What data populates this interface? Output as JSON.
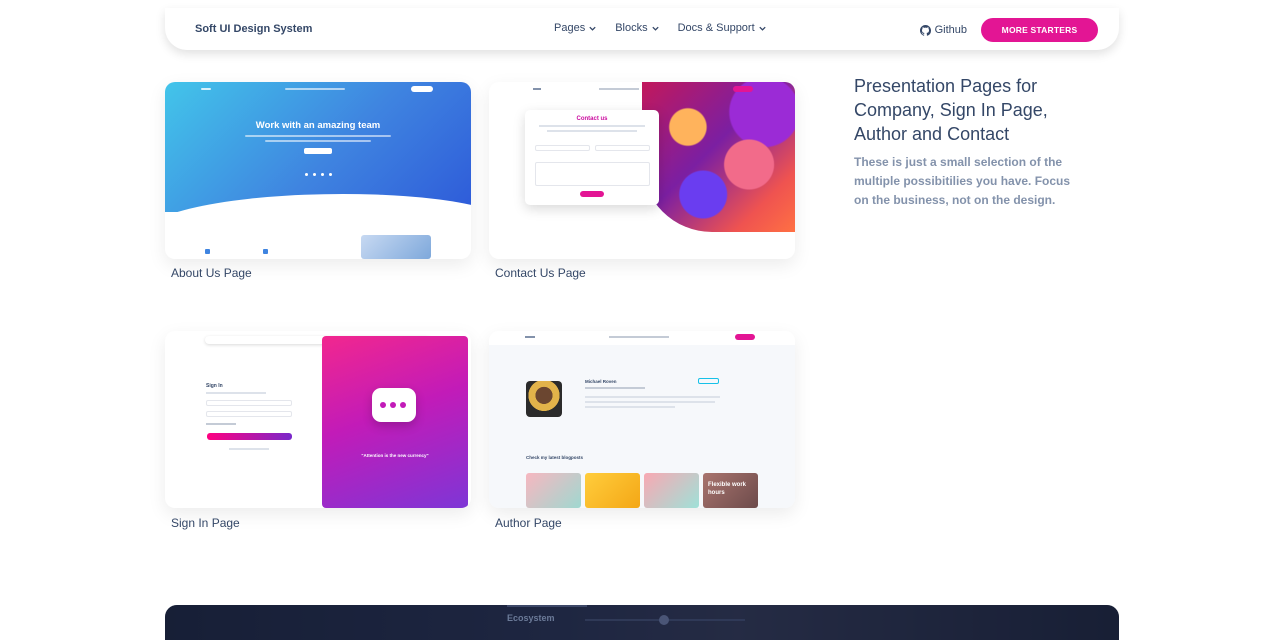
{
  "navbar": {
    "brand": "Soft UI Design System",
    "links": [
      {
        "label": "Pages"
      },
      {
        "label": "Blocks"
      },
      {
        "label": "Docs & Support"
      }
    ],
    "github_label": "Github",
    "cta_label": "MORE STARTERS",
    "cta_color": "#e31594"
  },
  "cards": [
    {
      "label": "About Us Page",
      "preview_title": "Work with an amazing team"
    },
    {
      "label": "Contact Us Page",
      "preview_title": "Contact us"
    },
    {
      "label": "Sign In Page",
      "preview_title": "Sign In",
      "preview_quote": "\"Attention is the new currency\""
    },
    {
      "label": "Author Page",
      "preview_name": "Michael Roven",
      "preview_section": "Check my latest blogposts",
      "preview_card": "Flexible work hours"
    }
  ],
  "presentation": {
    "title": "Presentation Pages for Company, Sign In Page, Author and Contact",
    "description": "These is just a small selection of the multiple possibitilies you have. Focus on the business, not on the design."
  },
  "banner": {
    "text": "Ecosystem"
  },
  "colors": {
    "primary_text": "#344767",
    "secondary_text": "#8392ab",
    "accent": "#e31594"
  }
}
